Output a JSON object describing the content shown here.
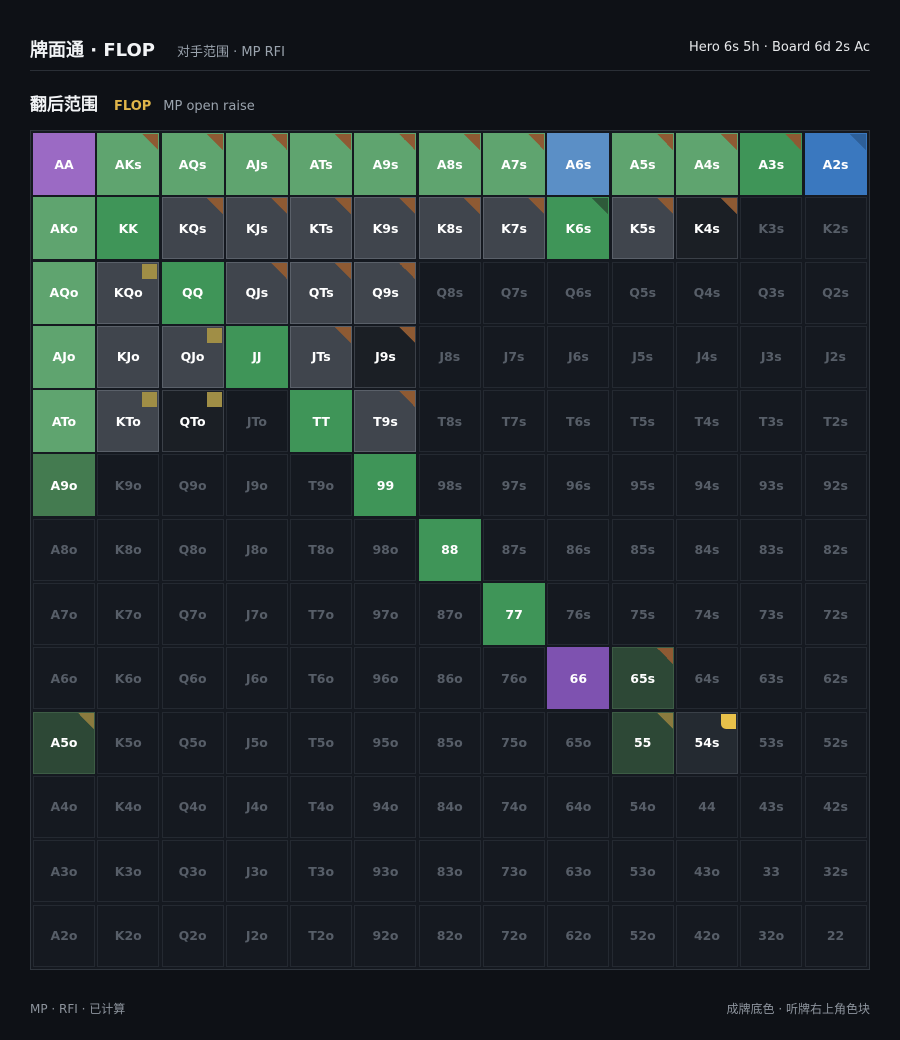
{
  "header": {
    "app_title": "牌面通 · FLOP",
    "subtitle": "对手范围 · MP RFI",
    "hand_info": "Hero 6s 5h · Board 6d 2s Ac"
  },
  "section": {
    "title": "翻后范围",
    "street": "FLOP",
    "note": "MP open raise"
  },
  "footer": {
    "left": "MP · RFI · 已计算",
    "right": "成牌底色 · 听牌右上角色块"
  },
  "colors": {
    "background": "#0e1116",
    "strong_made": "#5fa46f",
    "pair": "#3f9558",
    "set_or_trips": "#9b6ac4",
    "top_pair_ace_blue": "#5b8fc6",
    "draw_corner_brown": "#8e5a33",
    "draw_corner_gold": "#e8c14a"
  },
  "grid": {
    "rows": [
      [
        [
          "AA",
          "t-purple",
          ""
        ],
        [
          "AKs",
          "t-strong",
          "tri-brown"
        ],
        [
          "AQs",
          "t-strong",
          "tri-brown"
        ],
        [
          "AJs",
          "t-strong",
          "tri-brown"
        ],
        [
          "ATs",
          "t-strong",
          "tri-brown"
        ],
        [
          "A9s",
          "t-strong",
          "tri-brown"
        ],
        [
          "A8s",
          "t-strong",
          "tri-brown"
        ],
        [
          "A7s",
          "t-strong",
          "tri-brown"
        ],
        [
          "A6s",
          "t-blue",
          ""
        ],
        [
          "A5s",
          "t-strong",
          "tri-brown"
        ],
        [
          "A4s",
          "t-strong",
          "tri-brown"
        ],
        [
          "A3s",
          "t-pair",
          "tri-brown"
        ],
        [
          "A2s",
          "t-blue2",
          "tri-blue"
        ]
      ],
      [
        [
          "AKo",
          "t-strong",
          ""
        ],
        [
          "KK",
          "t-pair",
          ""
        ],
        [
          "KQs",
          "t-gray",
          "tri-brown"
        ],
        [
          "KJs",
          "t-gray",
          "tri-brown"
        ],
        [
          "KTs",
          "t-gray",
          "tri-brown"
        ],
        [
          "K9s",
          "t-gray",
          "tri-brown"
        ],
        [
          "K8s",
          "t-gray",
          "tri-brown"
        ],
        [
          "K7s",
          "t-gray",
          "tri-brown"
        ],
        [
          "K6s",
          "t-pair",
          "tri-green"
        ],
        [
          "K5s",
          "t-gray",
          "tri-brown"
        ],
        [
          "K4s",
          "t-black",
          "tri-brown"
        ],
        [
          "K3s",
          "",
          ""
        ],
        [
          "K2s",
          "",
          ""
        ]
      ],
      [
        [
          "AQo",
          "t-strong",
          ""
        ],
        [
          "KQo",
          "t-gray",
          "sq-olive"
        ],
        [
          "QQ",
          "t-pair",
          ""
        ],
        [
          "QJs",
          "t-gray",
          "tri-brown"
        ],
        [
          "QTs",
          "t-gray",
          "tri-brown"
        ],
        [
          "Q9s",
          "t-gray",
          "tri-brown"
        ],
        [
          "Q8s",
          "",
          ""
        ],
        [
          "Q7s",
          "",
          ""
        ],
        [
          "Q6s",
          "",
          ""
        ],
        [
          "Q5s",
          "",
          ""
        ],
        [
          "Q4s",
          "",
          ""
        ],
        [
          "Q3s",
          "",
          ""
        ],
        [
          "Q2s",
          "",
          ""
        ]
      ],
      [
        [
          "AJo",
          "t-strong",
          ""
        ],
        [
          "KJo",
          "t-gray",
          ""
        ],
        [
          "QJo",
          "t-gray",
          "sq-olive"
        ],
        [
          "JJ",
          "t-pair",
          ""
        ],
        [
          "JTs",
          "t-gray",
          "tri-brown"
        ],
        [
          "J9s",
          "t-black",
          "tri-brown"
        ],
        [
          "J8s",
          "",
          ""
        ],
        [
          "J7s",
          "",
          ""
        ],
        [
          "J6s",
          "",
          ""
        ],
        [
          "J5s",
          "",
          ""
        ],
        [
          "J4s",
          "",
          ""
        ],
        [
          "J3s",
          "",
          ""
        ],
        [
          "J2s",
          "",
          ""
        ]
      ],
      [
        [
          "ATo",
          "t-strong",
          ""
        ],
        [
          "KTo",
          "t-gray",
          "sq-olive"
        ],
        [
          "QTo",
          "t-black",
          "sq-olive"
        ],
        [
          "JTo",
          "",
          ""
        ],
        [
          "TT",
          "t-pair",
          ""
        ],
        [
          "T9s",
          "t-gray",
          "tri-brown"
        ],
        [
          "T8s",
          "",
          ""
        ],
        [
          "T7s",
          "",
          ""
        ],
        [
          "T6s",
          "",
          ""
        ],
        [
          "T5s",
          "",
          ""
        ],
        [
          "T4s",
          "",
          ""
        ],
        [
          "T3s",
          "",
          ""
        ],
        [
          "T2s",
          "",
          ""
        ]
      ],
      [
        [
          "A9o",
          "t-mid",
          ""
        ],
        [
          "K9o",
          "",
          ""
        ],
        [
          "Q9o",
          "",
          ""
        ],
        [
          "J9o",
          "",
          ""
        ],
        [
          "T9o",
          "",
          ""
        ],
        [
          "99",
          "t-pair",
          ""
        ],
        [
          "98s",
          "",
          ""
        ],
        [
          "97s",
          "",
          ""
        ],
        [
          "96s",
          "",
          ""
        ],
        [
          "95s",
          "",
          ""
        ],
        [
          "94s",
          "",
          ""
        ],
        [
          "93s",
          "",
          ""
        ],
        [
          "92s",
          "",
          ""
        ]
      ],
      [
        [
          "A8o",
          "",
          ""
        ],
        [
          "K8o",
          "",
          ""
        ],
        [
          "Q8o",
          "",
          ""
        ],
        [
          "J8o",
          "",
          ""
        ],
        [
          "T8o",
          "",
          ""
        ],
        [
          "98o",
          "",
          ""
        ],
        [
          "88",
          "t-pair",
          ""
        ],
        [
          "87s",
          "",
          ""
        ],
        [
          "86s",
          "",
          ""
        ],
        [
          "85s",
          "",
          ""
        ],
        [
          "84s",
          "",
          ""
        ],
        [
          "83s",
          "",
          ""
        ],
        [
          "82s",
          "",
          ""
        ]
      ],
      [
        [
          "A7o",
          "",
          ""
        ],
        [
          "K7o",
          "",
          ""
        ],
        [
          "Q7o",
          "",
          ""
        ],
        [
          "J7o",
          "",
          ""
        ],
        [
          "T7o",
          "",
          ""
        ],
        [
          "97o",
          "",
          ""
        ],
        [
          "87o",
          "",
          ""
        ],
        [
          "77",
          "t-pair",
          ""
        ],
        [
          "76s",
          "",
          ""
        ],
        [
          "75s",
          "",
          ""
        ],
        [
          "74s",
          "",
          ""
        ],
        [
          "73s",
          "",
          ""
        ],
        [
          "72s",
          "",
          ""
        ]
      ],
      [
        [
          "A6o",
          "",
          ""
        ],
        [
          "K6o",
          "",
          ""
        ],
        [
          "Q6o",
          "",
          ""
        ],
        [
          "J6o",
          "",
          ""
        ],
        [
          "T6o",
          "",
          ""
        ],
        [
          "96o",
          "",
          ""
        ],
        [
          "86o",
          "",
          ""
        ],
        [
          "76o",
          "",
          ""
        ],
        [
          "66",
          "t-purple2",
          ""
        ],
        [
          "65s",
          "t-dark",
          "tri-brown"
        ],
        [
          "64s",
          "",
          ""
        ],
        [
          "63s",
          "",
          ""
        ],
        [
          "62s",
          "",
          ""
        ]
      ],
      [
        [
          "A5o",
          "t-dark",
          "tri-olive"
        ],
        [
          "K5o",
          "",
          ""
        ],
        [
          "Q5o",
          "",
          ""
        ],
        [
          "J5o",
          "",
          ""
        ],
        [
          "T5o",
          "",
          ""
        ],
        [
          "95o",
          "",
          ""
        ],
        [
          "85o",
          "",
          ""
        ],
        [
          "75o",
          "",
          ""
        ],
        [
          "65o",
          "",
          ""
        ],
        [
          "55",
          "t-dark",
          "tri-olive"
        ],
        [
          "54s",
          "t-slate",
          "sq-gold"
        ],
        [
          "53s",
          "",
          ""
        ],
        [
          "52s",
          "",
          ""
        ]
      ],
      [
        [
          "A4o",
          "",
          ""
        ],
        [
          "K4o",
          "",
          ""
        ],
        [
          "Q4o",
          "",
          ""
        ],
        [
          "J4o",
          "",
          ""
        ],
        [
          "T4o",
          "",
          ""
        ],
        [
          "94o",
          "",
          ""
        ],
        [
          "84o",
          "",
          ""
        ],
        [
          "74o",
          "",
          ""
        ],
        [
          "64o",
          "",
          ""
        ],
        [
          "54o",
          "",
          ""
        ],
        [
          "44",
          "",
          ""
        ],
        [
          "43s",
          "",
          ""
        ],
        [
          "42s",
          "",
          ""
        ]
      ],
      [
        [
          "A3o",
          "",
          ""
        ],
        [
          "K3o",
          "",
          ""
        ],
        [
          "Q3o",
          "",
          ""
        ],
        [
          "J3o",
          "",
          ""
        ],
        [
          "T3o",
          "",
          ""
        ],
        [
          "93o",
          "",
          ""
        ],
        [
          "83o",
          "",
          ""
        ],
        [
          "73o",
          "",
          ""
        ],
        [
          "63o",
          "",
          ""
        ],
        [
          "53o",
          "",
          ""
        ],
        [
          "43o",
          "",
          ""
        ],
        [
          "33",
          "",
          ""
        ],
        [
          "32s",
          "",
          ""
        ]
      ],
      [
        [
          "A2o",
          "",
          ""
        ],
        [
          "K2o",
          "",
          ""
        ],
        [
          "Q2o",
          "",
          ""
        ],
        [
          "J2o",
          "",
          ""
        ],
        [
          "T2o",
          "",
          ""
        ],
        [
          "92o",
          "",
          ""
        ],
        [
          "82o",
          "",
          ""
        ],
        [
          "72o",
          "",
          ""
        ],
        [
          "62o",
          "",
          ""
        ],
        [
          "52o",
          "",
          ""
        ],
        [
          "42o",
          "",
          ""
        ],
        [
          "32o",
          "",
          ""
        ],
        [
          "22",
          "",
          ""
        ]
      ]
    ]
  }
}
